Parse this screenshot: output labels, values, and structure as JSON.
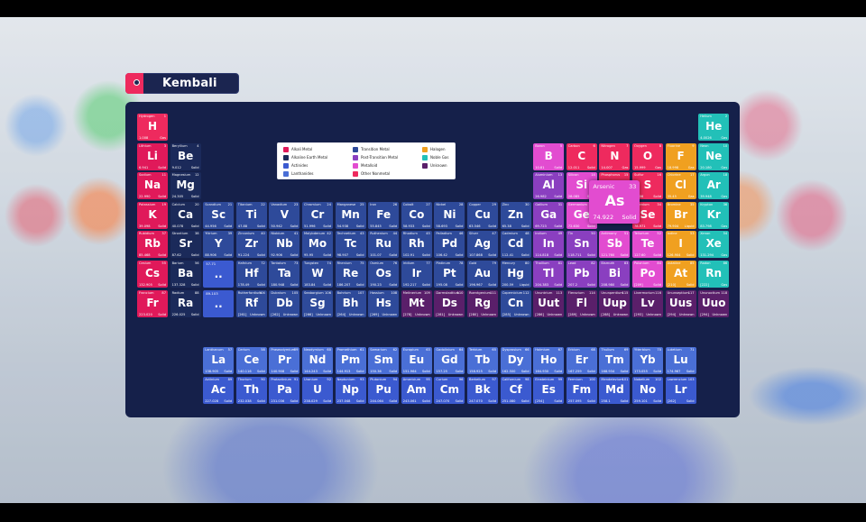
{
  "back_button": {
    "label": "Kembali"
  },
  "legend": [
    {
      "label": "Alkali Metal",
      "color": "#e0195a"
    },
    {
      "label": "Alkaline Earth Metal",
      "color": "#1b2a5a"
    },
    {
      "label": "Actinides",
      "color": "#3b5ad0"
    },
    {
      "label": "Lanthanides",
      "color": "#4a6fd6"
    },
    {
      "label": "Transition Metal",
      "color": "#2e4a9a"
    },
    {
      "label": "Post-Transition Metal",
      "color": "#8a3fc0"
    },
    {
      "label": "Metalloid",
      "color": "#e24cd0"
    },
    {
      "label": "Other Nonmetal",
      "color": "#ee2a5e"
    },
    {
      "label": "Halogen",
      "color": "#f0a020"
    },
    {
      "label": "Noble Gas",
      "color": "#22c0b8"
    },
    {
      "label": "Unknown",
      "color": "#5a1f6a"
    }
  ],
  "placeholders": [
    {
      "range": "57-71",
      "symbol": ".."
    },
    {
      "range": "89-103",
      "symbol": ".."
    }
  ],
  "highlight": {
    "name": "Arsenic",
    "number": "33",
    "symbol": "As",
    "mass": "74.922",
    "state": "Solid"
  },
  "elements": [
    {
      "name": "Hydrogen",
      "number": "1",
      "symbol": "H",
      "mass": "1.008",
      "state": "Gas",
      "cat": "nonmetal"
    },
    {
      "name": "Helium",
      "number": "2",
      "symbol": "He",
      "mass": "4.0026",
      "state": "Gas",
      "cat": "noble"
    },
    {
      "name": "Lithium",
      "number": "3",
      "symbol": "Li",
      "mass": "6.941",
      "state": "Solid",
      "cat": "alkali"
    },
    {
      "name": "Beryllium",
      "number": "4",
      "symbol": "Be",
      "mass": "9.012",
      "state": "Solid",
      "cat": "alkaline"
    },
    {
      "name": "Boron",
      "number": "5",
      "symbol": "B",
      "mass": "10.81",
      "state": "Solid",
      "cat": "metalloid"
    },
    {
      "name": "Carbon",
      "number": "6",
      "symbol": "C",
      "mass": "12.011",
      "state": "Solid",
      "cat": "nonmetal"
    },
    {
      "name": "Nitrogen",
      "number": "7",
      "symbol": "N",
      "mass": "14.007",
      "state": "Gas",
      "cat": "nonmetal"
    },
    {
      "name": "Oxygen",
      "number": "8",
      "symbol": "O",
      "mass": "15.999",
      "state": "Gas",
      "cat": "nonmetal"
    },
    {
      "name": "Fluorine",
      "number": "9",
      "symbol": "F",
      "mass": "18.998",
      "state": "Gas",
      "cat": "halogen"
    },
    {
      "name": "Neon",
      "number": "10",
      "symbol": "Ne",
      "mass": "20.180",
      "state": "Gas",
      "cat": "noble"
    },
    {
      "name": "Sodium",
      "number": "11",
      "symbol": "Na",
      "mass": "22.990",
      "state": "Solid",
      "cat": "alkali"
    },
    {
      "name": "Magnesium",
      "number": "12",
      "symbol": "Mg",
      "mass": "24.305",
      "state": "Solid",
      "cat": "alkaline"
    },
    {
      "name": "Aluminium",
      "number": "13",
      "symbol": "Al",
      "mass": "26.982",
      "state": "Solid",
      "cat": "post"
    },
    {
      "name": "Silicon",
      "number": "14",
      "symbol": "Si",
      "mass": "28.085",
      "state": "Solid",
      "cat": "metalloid"
    },
    {
      "name": "Phosphorus",
      "number": "15",
      "symbol": "P",
      "mass": "30.974",
      "state": "Solid",
      "cat": "nonmetal"
    },
    {
      "name": "Sulfur",
      "number": "16",
      "symbol": "S",
      "mass": "32.06",
      "state": "Solid",
      "cat": "nonmetal"
    },
    {
      "name": "Chlorine",
      "number": "17",
      "symbol": "Cl",
      "mass": "35.45",
      "state": "Gas",
      "cat": "halogen"
    },
    {
      "name": "Argon",
      "number": "18",
      "symbol": "Ar",
      "mass": "39.948",
      "state": "Gas",
      "cat": "noble"
    },
    {
      "name": "Potassium",
      "number": "19",
      "symbol": "K",
      "mass": "39.098",
      "state": "Solid",
      "cat": "alkali"
    },
    {
      "name": "Calcium",
      "number": "20",
      "symbol": "Ca",
      "mass": "40.078",
      "state": "Solid",
      "cat": "alkaline"
    },
    {
      "name": "Scandium",
      "number": "21",
      "symbol": "Sc",
      "mass": "44.956",
      "state": "Solid",
      "cat": "transition"
    },
    {
      "name": "Titanium",
      "number": "22",
      "symbol": "Ti",
      "mass": "47.88",
      "state": "Solid",
      "cat": "transition"
    },
    {
      "name": "Vanadium",
      "number": "23",
      "symbol": "V",
      "mass": "50.942",
      "state": "Solid",
      "cat": "transition"
    },
    {
      "name": "Chromium",
      "number": "24",
      "symbol": "Cr",
      "mass": "51.996",
      "state": "Solid",
      "cat": "transition"
    },
    {
      "name": "Manganese",
      "number": "25",
      "symbol": "Mn",
      "mass": "54.938",
      "state": "Solid",
      "cat": "transition"
    },
    {
      "name": "Iron",
      "number": "26",
      "symbol": "Fe",
      "mass": "55.845",
      "state": "Solid",
      "cat": "transition"
    },
    {
      "name": "Cobalt",
      "number": "27",
      "symbol": "Co",
      "mass": "58.933",
      "state": "Solid",
      "cat": "transition"
    },
    {
      "name": "Nickel",
      "number": "28",
      "symbol": "Ni",
      "mass": "58.693",
      "state": "Solid",
      "cat": "transition"
    },
    {
      "name": "Copper",
      "number": "29",
      "symbol": "Cu",
      "mass": "63.546",
      "state": "Solid",
      "cat": "transition"
    },
    {
      "name": "Zinc",
      "number": "30",
      "symbol": "Zn",
      "mass": "65.38",
      "state": "Solid",
      "cat": "transition"
    },
    {
      "name": "Gallium",
      "number": "31",
      "symbol": "Ga",
      "mass": "69.723",
      "state": "Solid",
      "cat": "post"
    },
    {
      "name": "Germanium",
      "number": "32",
      "symbol": "Ge",
      "mass": "72.630",
      "state": "Solid",
      "cat": "metalloid"
    },
    {
      "name": "Selenium",
      "number": "34",
      "symbol": "Se",
      "mass": "78.971",
      "state": "Solid",
      "cat": "nonmetal"
    },
    {
      "name": "Bromine",
      "number": "35",
      "symbol": "Br",
      "mass": "79.904",
      "state": "Liquid",
      "cat": "halogen"
    },
    {
      "name": "Krypton",
      "number": "36",
      "symbol": "Kr",
      "mass": "83.798",
      "state": "Gas",
      "cat": "noble"
    },
    {
      "name": "Rubidium",
      "number": "37",
      "symbol": "Rb",
      "mass": "85.468",
      "state": "Solid",
      "cat": "alkali"
    },
    {
      "name": "Strontium",
      "number": "38",
      "symbol": "Sr",
      "mass": "87.62",
      "state": "Solid",
      "cat": "alkaline"
    },
    {
      "name": "Yttrium",
      "number": "39",
      "symbol": "Y",
      "mass": "88.906",
      "state": "Solid",
      "cat": "transition"
    },
    {
      "name": "Zirconium",
      "number": "40",
      "symbol": "Zr",
      "mass": "91.224",
      "state": "Solid",
      "cat": "transition"
    },
    {
      "name": "Niobium",
      "number": "41",
      "symbol": "Nb",
      "mass": "92.906",
      "state": "Solid",
      "cat": "transition"
    },
    {
      "name": "Molybdenum",
      "number": "42",
      "symbol": "Mo",
      "mass": "95.95",
      "state": "Solid",
      "cat": "transition"
    },
    {
      "name": "Technetium",
      "number": "43",
      "symbol": "Tc",
      "mass": "98.907",
      "state": "Solid",
      "cat": "transition"
    },
    {
      "name": "Ruthenium",
      "number": "44",
      "symbol": "Ru",
      "mass": "101.07",
      "state": "Solid",
      "cat": "transition"
    },
    {
      "name": "Rhodium",
      "number": "45",
      "symbol": "Rh",
      "mass": "102.91",
      "state": "Solid",
      "cat": "transition"
    },
    {
      "name": "Palladium",
      "number": "46",
      "symbol": "Pd",
      "mass": "106.42",
      "state": "Solid",
      "cat": "transition"
    },
    {
      "name": "Silver",
      "number": "47",
      "symbol": "Ag",
      "mass": "107.868",
      "state": "Solid",
      "cat": "transition"
    },
    {
      "name": "Cadmium",
      "number": "48",
      "symbol": "Cd",
      "mass": "112.41",
      "state": "Solid",
      "cat": "transition"
    },
    {
      "name": "Indium",
      "number": "49",
      "symbol": "In",
      "mass": "114.818",
      "state": "Solid",
      "cat": "post"
    },
    {
      "name": "Tin",
      "number": "50",
      "symbol": "Sn",
      "mass": "118.711",
      "state": "Solid",
      "cat": "post"
    },
    {
      "name": "Antimony",
      "number": "51",
      "symbol": "Sb",
      "mass": "121.760",
      "state": "Solid",
      "cat": "metalloid"
    },
    {
      "name": "Tellurium",
      "number": "52",
      "symbol": "Te",
      "mass": "127.60",
      "state": "Solid",
      "cat": "metalloid"
    },
    {
      "name": "Iodine",
      "number": "53",
      "symbol": "I",
      "mass": "126.904",
      "state": "Solid",
      "cat": "halogen"
    },
    {
      "name": "Xenon",
      "number": "54",
      "symbol": "Xe",
      "mass": "131.294",
      "state": "Gas",
      "cat": "noble"
    },
    {
      "name": "Cesium",
      "number": "55",
      "symbol": "Cs",
      "mass": "132.905",
      "state": "Solid",
      "cat": "alkali"
    },
    {
      "name": "Barium",
      "number": "56",
      "symbol": "Ba",
      "mass": "137.328",
      "state": "Solid",
      "cat": "alkaline"
    },
    {
      "name": "Hafnium",
      "number": "72",
      "symbol": "Hf",
      "mass": "178.49",
      "state": "Solid",
      "cat": "transition"
    },
    {
      "name": "Tantalum",
      "number": "73",
      "symbol": "Ta",
      "mass": "180.948",
      "state": "Solid",
      "cat": "transition"
    },
    {
      "name": "Tungsten",
      "number": "74",
      "symbol": "W",
      "mass": "183.84",
      "state": "Solid",
      "cat": "transition"
    },
    {
      "name": "Rhenium",
      "number": "75",
      "symbol": "Re",
      "mass": "186.207",
      "state": "Solid",
      "cat": "transition"
    },
    {
      "name": "Osmium",
      "number": "76",
      "symbol": "Os",
      "mass": "190.23",
      "state": "Solid",
      "cat": "transition"
    },
    {
      "name": "Iridium",
      "number": "77",
      "symbol": "Ir",
      "mass": "192.217",
      "state": "Solid",
      "cat": "transition"
    },
    {
      "name": "Platinum",
      "number": "78",
      "symbol": "Pt",
      "mass": "195.08",
      "state": "Solid",
      "cat": "transition"
    },
    {
      "name": "Gold",
      "number": "79",
      "symbol": "Au",
      "mass": "196.967",
      "state": "Solid",
      "cat": "transition"
    },
    {
      "name": "Mercury",
      "number": "80",
      "symbol": "Hg",
      "mass": "200.59",
      "state": "Liquid",
      "cat": "transition"
    },
    {
      "name": "Thallium",
      "number": "81",
      "symbol": "Tl",
      "mass": "204.383",
      "state": "Solid",
      "cat": "post"
    },
    {
      "name": "Lead",
      "number": "82",
      "symbol": "Pb",
      "mass": "207.2",
      "state": "Solid",
      "cat": "post"
    },
    {
      "name": "Bismuth",
      "number": "83",
      "symbol": "Bi",
      "mass": "208.980",
      "state": "Solid",
      "cat": "post"
    },
    {
      "name": "Polonium",
      "number": "84",
      "symbol": "Po",
      "mass": "[209]",
      "state": "Solid",
      "cat": "metalloid"
    },
    {
      "name": "Astatine",
      "number": "85",
      "symbol": "At",
      "mass": "[210]",
      "state": "Solid",
      "cat": "halogen"
    },
    {
      "name": "Radon",
      "number": "86",
      "symbol": "Rn",
      "mass": "[222]",
      "state": "Gas",
      "cat": "noble"
    },
    {
      "name": "Francium",
      "number": "87",
      "symbol": "Fr",
      "mass": "223.020",
      "state": "Solid",
      "cat": "alkali"
    },
    {
      "name": "Radium",
      "number": "88",
      "symbol": "Ra",
      "mass": "226.025",
      "state": "Solid",
      "cat": "alkaline"
    },
    {
      "name": "Rutherfordium",
      "number": "104",
      "symbol": "Rf",
      "mass": "[261]",
      "state": "Unknown",
      "cat": "transition"
    },
    {
      "name": "Dubnium",
      "number": "105",
      "symbol": "Db",
      "mass": "[262]",
      "state": "Unknown",
      "cat": "transition"
    },
    {
      "name": "Seaborgium",
      "number": "106",
      "symbol": "Sg",
      "mass": "[266]",
      "state": "Unknown",
      "cat": "transition"
    },
    {
      "name": "Bohrium",
      "number": "107",
      "symbol": "Bh",
      "mass": "[264]",
      "state": "Unknown",
      "cat": "transition"
    },
    {
      "name": "Hassium",
      "number": "108",
      "symbol": "Hs",
      "mass": "[269]",
      "state": "Unknown",
      "cat": "transition"
    },
    {
      "name": "Meitnerium",
      "number": "109",
      "symbol": "Mt",
      "mass": "[278]",
      "state": "Unknown",
      "cat": "unknown"
    },
    {
      "name": "Darmstadtium",
      "number": "110",
      "symbol": "Ds",
      "mass": "[281]",
      "state": "Unknown",
      "cat": "unknown"
    },
    {
      "name": "Roentgenium",
      "number": "111",
      "symbol": "Rg",
      "mass": "[280]",
      "state": "Unknown",
      "cat": "unknown"
    },
    {
      "name": "Copernicium",
      "number": "112",
      "symbol": "Cn",
      "mass": "[285]",
      "state": "Unknown",
      "cat": "transition"
    },
    {
      "name": "Ununtrium",
      "number": "113",
      "symbol": "Uut",
      "mass": "[286]",
      "state": "Unknown",
      "cat": "unknown"
    },
    {
      "name": "Flerovium",
      "number": "114",
      "symbol": "Fl",
      "mass": "[289]",
      "state": "Unknown",
      "cat": "unknown"
    },
    {
      "name": "Ununpentium",
      "number": "115",
      "symbol": "Uup",
      "mass": "[288]",
      "state": "Unknown",
      "cat": "unknown"
    },
    {
      "name": "Livermorium",
      "number": "116",
      "symbol": "Lv",
      "mass": "[293]",
      "state": "Unknown",
      "cat": "unknown"
    },
    {
      "name": "Ununseptium",
      "number": "117",
      "symbol": "Uus",
      "mass": "[294]",
      "state": "Unknown",
      "cat": "unknown"
    },
    {
      "name": "Ununoctium",
      "number": "118",
      "symbol": "Uuo",
      "mass": "[294]",
      "state": "Unknown",
      "cat": "unknown"
    },
    {
      "name": "Lanthanum",
      "number": "57",
      "symbol": "La",
      "mass": "138.905",
      "state": "Solid",
      "cat": "lanth"
    },
    {
      "name": "Cerium",
      "number": "58",
      "symbol": "Ce",
      "mass": "140.116",
      "state": "Solid",
      "cat": "lanth"
    },
    {
      "name": "Praseodymium",
      "number": "59",
      "symbol": "Pr",
      "mass": "140.908",
      "state": "Solid",
      "cat": "lanth"
    },
    {
      "name": "Neodymium",
      "number": "60",
      "symbol": "Nd",
      "mass": "144.243",
      "state": "Solid",
      "cat": "lanth"
    },
    {
      "name": "Promethium",
      "number": "61",
      "symbol": "Pm",
      "mass": "144.913",
      "state": "Solid",
      "cat": "lanth"
    },
    {
      "name": "Samarium",
      "number": "62",
      "symbol": "Sm",
      "mass": "150.36",
      "state": "Solid",
      "cat": "lanth"
    },
    {
      "name": "Europium",
      "number": "63",
      "symbol": "Eu",
      "mass": "151.964",
      "state": "Solid",
      "cat": "lanth"
    },
    {
      "name": "Gadolinium",
      "number": "64",
      "symbol": "Gd",
      "mass": "157.25",
      "state": "Solid",
      "cat": "lanth"
    },
    {
      "name": "Terbium",
      "number": "65",
      "symbol": "Tb",
      "mass": "158.925",
      "state": "Solid",
      "cat": "lanth"
    },
    {
      "name": "Dysprosium",
      "number": "66",
      "symbol": "Dy",
      "mass": "162.500",
      "state": "Solid",
      "cat": "lanth"
    },
    {
      "name": "Holmium",
      "number": "67",
      "symbol": "Ho",
      "mass": "164.930",
      "state": "Solid",
      "cat": "lanth"
    },
    {
      "name": "Erbium",
      "number": "68",
      "symbol": "Er",
      "mass": "167.259",
      "state": "Solid",
      "cat": "lanth"
    },
    {
      "name": "Thulium",
      "number": "69",
      "symbol": "Tm",
      "mass": "168.934",
      "state": "Solid",
      "cat": "lanth"
    },
    {
      "name": "Ytterbium",
      "number": "70",
      "symbol": "Yb",
      "mass": "173.055",
      "state": "Solid",
      "cat": "lanth"
    },
    {
      "name": "Lutetium",
      "number": "71",
      "symbol": "Lu",
      "mass": "174.967",
      "state": "Solid",
      "cat": "lanth"
    },
    {
      "name": "Actinium",
      "number": "89",
      "symbol": "Ac",
      "mass": "227.028",
      "state": "Solid",
      "cat": "actin"
    },
    {
      "name": "Thorium",
      "number": "90",
      "symbol": "Th",
      "mass": "232.038",
      "state": "Solid",
      "cat": "actin"
    },
    {
      "name": "Protactinium",
      "number": "91",
      "symbol": "Pa",
      "mass": "231.036",
      "state": "Solid",
      "cat": "actin"
    },
    {
      "name": "Uranium",
      "number": "92",
      "symbol": "U",
      "mass": "238.029",
      "state": "Solid",
      "cat": "actin"
    },
    {
      "name": "Neptunium",
      "number": "93",
      "symbol": "Np",
      "mass": "237.048",
      "state": "Solid",
      "cat": "actin"
    },
    {
      "name": "Plutonium",
      "number": "94",
      "symbol": "Pu",
      "mass": "244.064",
      "state": "Solid",
      "cat": "actin"
    },
    {
      "name": "Americium",
      "number": "95",
      "symbol": "Am",
      "mass": "243.061",
      "state": "Solid",
      "cat": "actin"
    },
    {
      "name": "Curium",
      "number": "96",
      "symbol": "Cm",
      "mass": "247.070",
      "state": "Solid",
      "cat": "actin"
    },
    {
      "name": "Berkelium",
      "number": "97",
      "symbol": "Bk",
      "mass": "247.070",
      "state": "Solid",
      "cat": "actin"
    },
    {
      "name": "Californium",
      "number": "98",
      "symbol": "Cf",
      "mass": "251.080",
      "state": "Solid",
      "cat": "actin"
    },
    {
      "name": "Einsteinium",
      "number": "99",
      "symbol": "Es",
      "mass": "[254]",
      "state": "Solid",
      "cat": "actin"
    },
    {
      "name": "Fermium",
      "number": "100",
      "symbol": "Fm",
      "mass": "257.095",
      "state": "Solid",
      "cat": "actin"
    },
    {
      "name": "Mendelevium",
      "number": "101",
      "symbol": "Md",
      "mass": "258.1",
      "state": "Solid",
      "cat": "actin"
    },
    {
      "name": "Nobelium",
      "number": "102",
      "symbol": "No",
      "mass": "259.101",
      "state": "Solid",
      "cat": "actin"
    },
    {
      "name": "Lawrencium",
      "number": "103",
      "symbol": "Lr",
      "mass": "[262]",
      "state": "Solid",
      "cat": "actin"
    }
  ],
  "category_colors": {
    "alkali": "#e0195a",
    "alkaline": "#1b2a5a",
    "transition": "#2e4a9a",
    "post": "#8a3fc0",
    "metalloid": "#e24cd0",
    "nonmetal": "#ee2a5e",
    "halogen": "#f0a020",
    "noble": "#22c0b8",
    "unknown": "#5a1f6a",
    "lanth": "#4a6fd6",
    "actin": "#3b5ad0"
  }
}
